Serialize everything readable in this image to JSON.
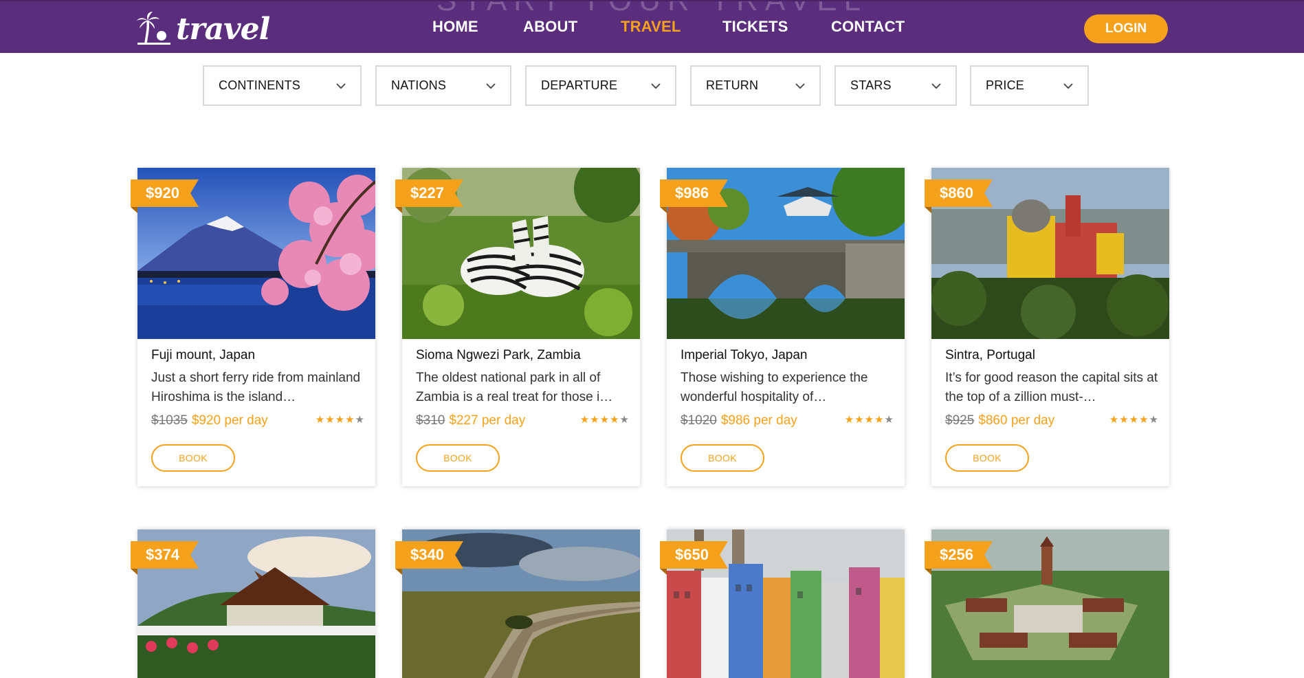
{
  "header": {
    "ghost_title": "START YOUR TRAVEL",
    "logo_text": "travel",
    "login_label": "LOGIN"
  },
  "nav": [
    {
      "label": "HOME",
      "active": false
    },
    {
      "label": "ABOUT",
      "active": false
    },
    {
      "label": "TRAVEL",
      "active": true
    },
    {
      "label": "TICKETS",
      "active": false
    },
    {
      "label": "CONTACT",
      "active": false
    }
  ],
  "filters": [
    {
      "label": "CONTINENTS"
    },
    {
      "label": "NATIONS"
    },
    {
      "label": "DEPARTURE"
    },
    {
      "label": "RETURN"
    },
    {
      "label": "STARS"
    },
    {
      "label": "PRICE"
    }
  ],
  "cards": [
    {
      "tag": "$920",
      "title": "Fuji mount, Japan",
      "desc": "Just a short ferry ride from mainland Hiroshima is the island…",
      "old": "$1035",
      "new": "$920 per day",
      "rating": 4,
      "book": "BOOK",
      "scene": "fuji"
    },
    {
      "tag": "$227",
      "title": "Sioma Ngwezi Park, Zambia",
      "desc": "The oldest national park in all of Zambia is a real treat for those i…",
      "old": "$310",
      "new": "$227 per day",
      "rating": 4,
      "book": "BOOK",
      "scene": "zebra"
    },
    {
      "tag": "$986",
      "title": "Imperial Tokyo, Japan",
      "desc": "Those wishing to experience the wonderful hospitality of…",
      "old": "$1020",
      "new": "$986 per day",
      "rating": 4,
      "book": "BOOK",
      "scene": "bridge"
    },
    {
      "tag": "$860",
      "title": "Sintra, Portugal",
      "desc": "It’s for good reason the capital sits at the top of a zillion must-…",
      "old": "$925",
      "new": "$860 per day",
      "rating": 4,
      "book": "BOOK",
      "scene": "castle"
    },
    {
      "tag": "$374",
      "scene": "temple"
    },
    {
      "tag": "$340",
      "scene": "river"
    },
    {
      "tag": "$650",
      "scene": "city"
    },
    {
      "tag": "$256",
      "scene": "pagoda"
    }
  ],
  "colors": {
    "header_bg": "#5b2e7d",
    "accent": "#f6a11b",
    "star_off": "#888888"
  },
  "icons": {
    "logo": "palm-tree-sun-icon",
    "filter": "chevron-down-icon",
    "star": "star-icon"
  }
}
